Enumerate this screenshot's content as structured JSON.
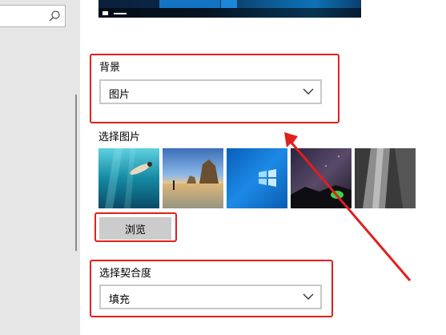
{
  "search": {
    "placeholder": "",
    "icon": "search-icon"
  },
  "background": {
    "label": "背景",
    "selected": "图片"
  },
  "choose_picture": {
    "label": "选择图片",
    "thumbnails": [
      "underwater-swimmer",
      "sea-stack-beach",
      "windows-logo-blue",
      "night-sky-tent",
      "waterfall-rock"
    ]
  },
  "browse": {
    "label": "浏览"
  },
  "fit": {
    "label": "选择契合度",
    "selected": "填充"
  },
  "colors": {
    "highlight": "#e0201c",
    "accent": "#0078d7"
  }
}
